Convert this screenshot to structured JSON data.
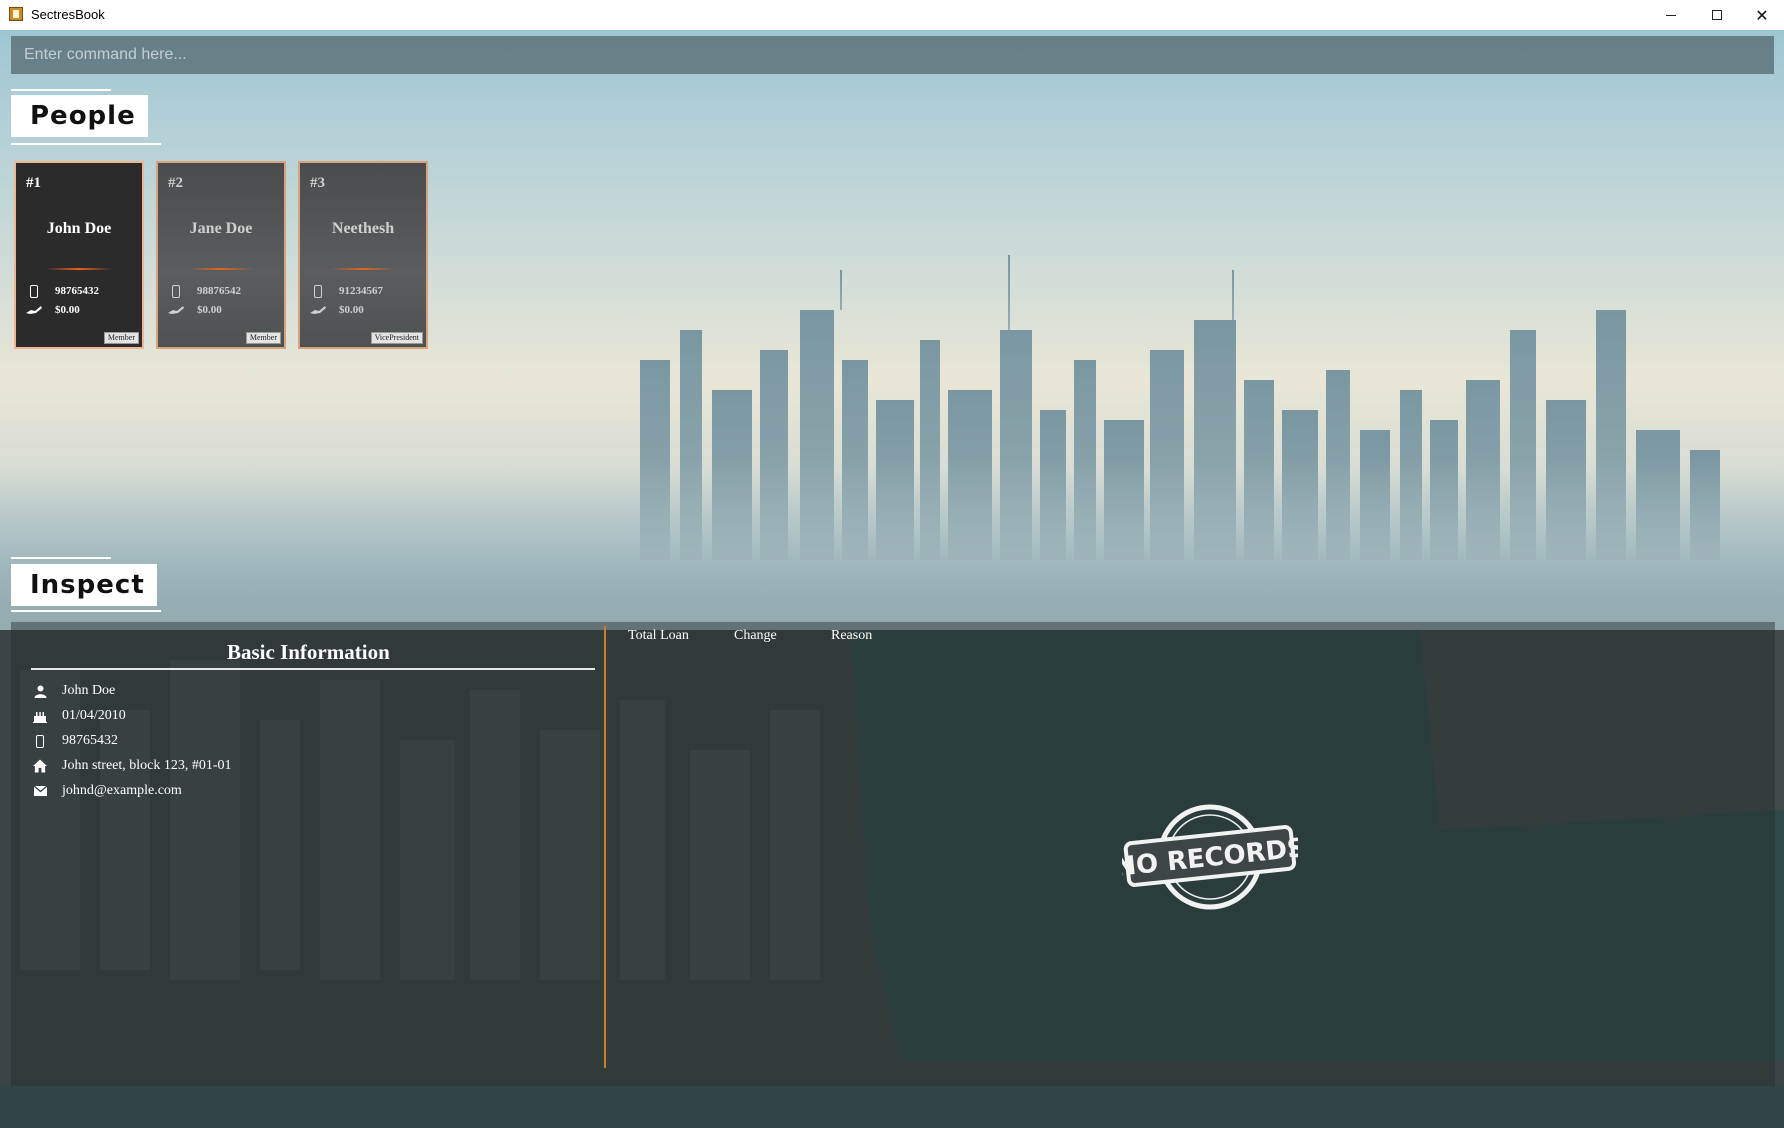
{
  "window": {
    "title": "SectresBook",
    "controls": [
      "minimize",
      "maximize",
      "close"
    ]
  },
  "command": {
    "placeholder": "Enter command here...",
    "value": ""
  },
  "people": {
    "header": "People",
    "cards": [
      {
        "index": "#1",
        "name": "John Doe",
        "phone": "98765432",
        "loan": "$0.00",
        "role": "Member",
        "selected": true
      },
      {
        "index": "#2",
        "name": "Jane Doe",
        "phone": "98876542",
        "loan": "$0.00",
        "role": "Member",
        "selected": false
      },
      {
        "index": "#3",
        "name": "Neethesh",
        "phone": "91234567",
        "loan": "$0.00",
        "role": "VicePresident",
        "selected": false
      }
    ]
  },
  "inspect": {
    "header": "Inspect",
    "basic_info": {
      "title": "Basic Information",
      "name": "John Doe",
      "birthday": "01/04/2010",
      "phone": "98765432",
      "address": "John street, block 123, #01-01",
      "email": "johnd@example.com"
    },
    "loan_table": {
      "columns": [
        "Total Loan",
        "Change",
        "Reason"
      ],
      "rows": [],
      "empty_stamp": "NO RECORDS"
    }
  },
  "colors": {
    "card_border": "#d9a27a",
    "card_divider": "#e8641a",
    "panel_divider": "#c8802e",
    "command_bg": "#5a7078"
  },
  "icons": {
    "person": "person-icon",
    "birthday": "cake-icon",
    "phone": "phone-icon",
    "address": "home-icon",
    "email": "mail-icon",
    "loan": "hand-money-icon"
  }
}
